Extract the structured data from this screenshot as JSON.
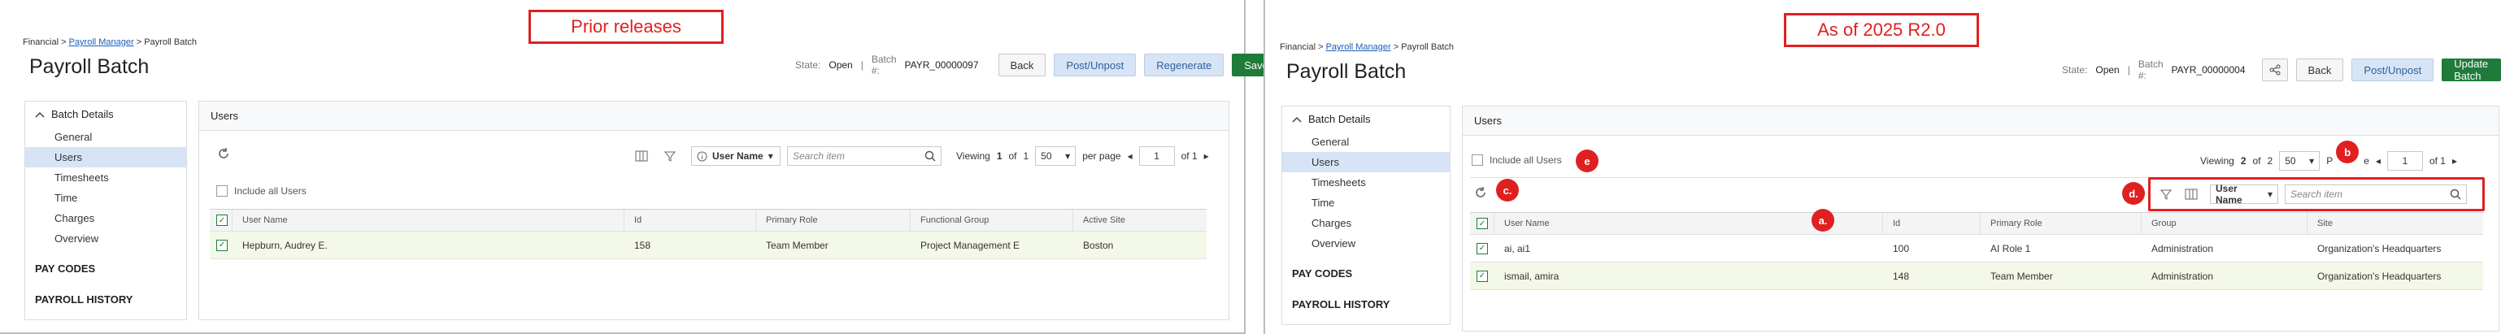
{
  "before": {
    "callout": "Prior releases",
    "breadcrumb": {
      "root": "Financial >",
      "link": "Payroll Manager",
      "current": "> Payroll Batch"
    },
    "title": "Payroll Batch",
    "state_label": "State:",
    "state_value": "Open",
    "batch_label": "Batch #:",
    "batch_value": "PAYR_00000097",
    "buttons": {
      "back": "Back",
      "post": "Post/Unpost",
      "regen": "Regenerate",
      "save": "Save"
    },
    "sidebar": {
      "group": "Batch Details",
      "items": [
        "General",
        "Users",
        "Timesheets",
        "Time",
        "Charges",
        "Overview"
      ],
      "links": [
        "PAY CODES",
        "PAYROLL HISTORY"
      ]
    },
    "section": "Users",
    "toolbar": {
      "field": "User Name",
      "placeholder": "Search item",
      "viewing": "Viewing",
      "viewing_num": "1",
      "of1": "of",
      "of_num": "1",
      "perpage": "50",
      "perpage_label": "per page",
      "page": "1",
      "of_pages": "of 1"
    },
    "include_all": "Include all Users",
    "columns": [
      "User Name",
      "Id",
      "Primary Role",
      "Functional Group",
      "Active Site"
    ],
    "rows": [
      [
        "Hepburn, Audrey E.",
        "158",
        "Team Member",
        "Project Management E",
        "Boston"
      ]
    ]
  },
  "after": {
    "callout": "As of 2025 R2.0",
    "breadcrumb": {
      "root": "Financial >",
      "link": "Payroll Manager",
      "current": "> Payroll Batch"
    },
    "title": "Payroll Batch",
    "state_label": "State:",
    "state_value": "Open",
    "batch_label": "Batch #:",
    "batch_value": "PAYR_00000004",
    "buttons": {
      "back": "Back",
      "post": "Post/Unpost",
      "update": "Update Batch"
    },
    "sidebar": {
      "group": "Batch Details",
      "items": [
        "General",
        "Users",
        "Timesheets",
        "Time",
        "Charges",
        "Overview"
      ],
      "links": [
        "PAY CODES",
        "PAYROLL HISTORY"
      ]
    },
    "section": "Users",
    "include_all": "Include all Users",
    "paging": {
      "viewing": "Viewing",
      "viewing_num": "2",
      "of_word": "of",
      "total": "2",
      "perpage": "50",
      "p_text": "P",
      "e_text": "e",
      "page": "1",
      "of_pages": "of 1"
    },
    "toolbar": {
      "field": "User Name",
      "placeholder": "Search item"
    },
    "columns": [
      "User Name",
      "Id",
      "Primary Role",
      "Group",
      "Site"
    ],
    "rows": [
      [
        "ai, ai1",
        "100",
        "AI Role 1",
        "Administration",
        "Organization's Headquarters"
      ],
      [
        "ismail, amira",
        "148",
        "Team Member",
        "Administration",
        "Organization's Headquarters"
      ]
    ],
    "badges": {
      "a": "a.",
      "b": "b",
      "c": "c.",
      "d": "d.",
      "e": "e"
    }
  },
  "colors": {
    "accent_red": "#e02020",
    "save_green": "#1e7b3a",
    "link_blue": "#1a5fb4"
  }
}
